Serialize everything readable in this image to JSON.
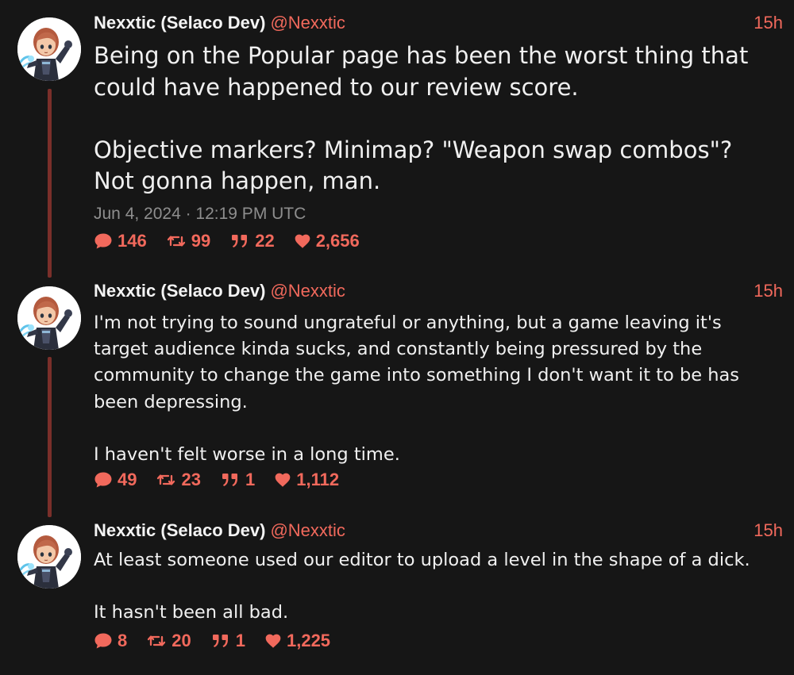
{
  "colors": {
    "background": "#161616",
    "accent": "#f1695c",
    "thread_line": "#7a2f2a",
    "text": "#f0f0f0",
    "muted": "#8e8e8e"
  },
  "tweets": [
    {
      "author": "Nexxtic (Selaco Dev)",
      "handle": "@Nexxtic",
      "time": "15h",
      "text": "Being on the Popular page has been the worst thing that\ncould have happened to our review score.\n\nObjective markers? Minimap? \"Weapon swap combos\"?\nNot gonna happen, man.",
      "date": "Jun 4, 2024 · 12:19 PM UTC",
      "stats": {
        "replies": "146",
        "retweets": "99",
        "quotes": "22",
        "likes": "2,656"
      },
      "icons": [
        "comment-icon",
        "retweet-icon",
        "quote-icon",
        "heart-icon"
      ]
    },
    {
      "author": "Nexxtic (Selaco Dev)",
      "handle": "@Nexxtic",
      "time": "15h",
      "text": "I'm not trying to sound ungrateful or anything, but a game leaving it's\ntarget audience kinda sucks, and constantly being pressured by the\ncommunity to change the game into something I don't want it to be has\nbeen depressing.\n\nI haven't felt worse in a long time.",
      "stats": {
        "replies": "49",
        "retweets": "23",
        "quotes": "1",
        "likes": "1,112"
      }
    },
    {
      "author": "Nexxtic (Selaco Dev)",
      "handle": "@Nexxtic",
      "time": "15h",
      "text": "At least someone used our editor to upload a level in the shape of a dick.\n\nIt hasn't been all bad.",
      "stats": {
        "replies": "8",
        "retweets": "20",
        "quotes": "1",
        "likes": "1,225"
      }
    }
  ]
}
